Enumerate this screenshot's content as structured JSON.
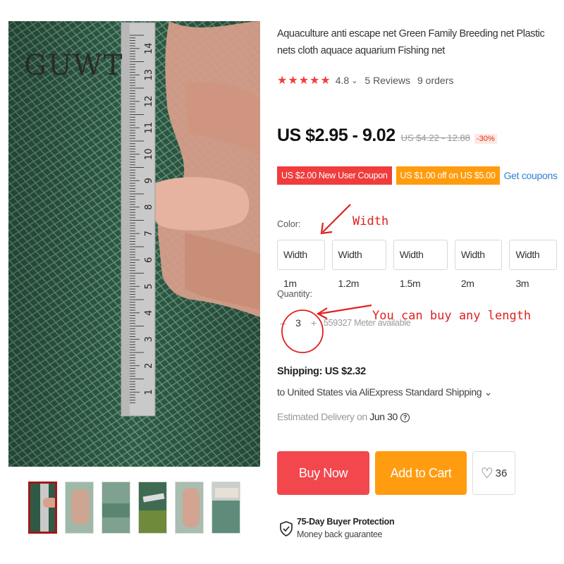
{
  "product": {
    "title": "Aquaculture anti escape net Green Family Breeding net Plastic nets cloth aquace aquarium Fishing net",
    "brand_logo_text": "GUWT"
  },
  "rating": {
    "stars": "★★★★★",
    "score": "4.8",
    "caret": "⌄",
    "reviews": "5 Reviews",
    "orders": "9 orders"
  },
  "price": {
    "current": "US $2.95 - 9.02",
    "original": "US $4.22 - 12.88",
    "discount": "-30%"
  },
  "coupons": {
    "new_user": "US $2.00 New User Coupon",
    "off": "US $1.00 off on US $5.00",
    "get_link": "Get coupons"
  },
  "color": {
    "label": "Color:",
    "options": [
      "Width 1m",
      "Width 1.2m",
      "Width 1.5m",
      "Width 2m",
      "Width 3m"
    ]
  },
  "annotations": {
    "width_note": "Width",
    "length_note": "You can buy any length"
  },
  "quantity": {
    "label": "Quantity:",
    "minus": "–",
    "value": "3",
    "plus": "+",
    "available": "559327 Meter available"
  },
  "shipping": {
    "title": "Shipping: US $2.32",
    "line": "to United States via AliExpress Standard Shipping ⌄",
    "delivery_prefix": "Estimated Delivery on ",
    "delivery_date": "Jun 30",
    "help_icon": "?"
  },
  "actions": {
    "buy_now": "Buy Now",
    "add_to_cart": "Add to Cart",
    "wishlist_count": "36",
    "heart": "♡"
  },
  "protection": {
    "title": "75-Day Buyer Protection",
    "subtitle": "Money back guarantee"
  },
  "ruler": {
    "numbers": [
      "14",
      "13",
      "12",
      "11",
      "10",
      "9",
      "8",
      "7",
      "6",
      "5",
      "4",
      "3",
      "2",
      "1"
    ]
  },
  "colors": {
    "net_green": "#2f5a45",
    "buy_now": "#f1474d",
    "add_to_cart": "#ff9c10",
    "accent_red": "#e02020",
    "link_blue": "#2f7fd1"
  }
}
